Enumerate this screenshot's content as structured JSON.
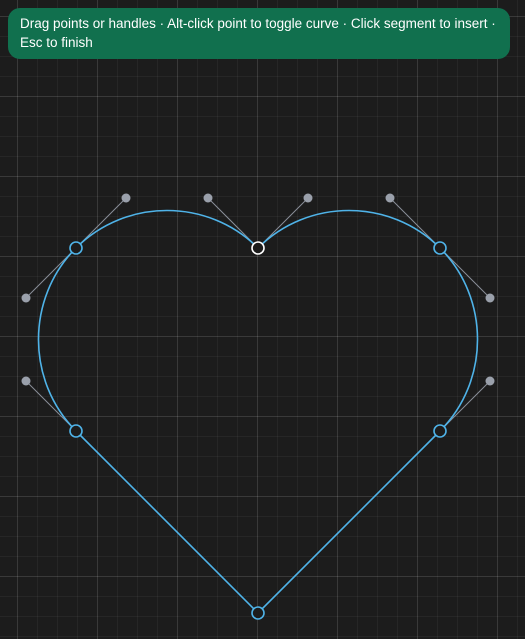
{
  "hint": {
    "text": "Drag points or handles · Alt-click point to toggle curve · Click segment to insert · Esc to finish"
  },
  "colors": {
    "background": "#1c1c1c",
    "banner": "#11704e",
    "path_stroke": "#4fb3e8",
    "anchor_fill": "#1c1c1c",
    "selected_anchor_stroke": "#ffffff",
    "handle_fill": "#9aa0ab",
    "handle_line": "#8a8f99"
  },
  "icons": {
    "anchor": "circle-anchor-point",
    "handle": "filled-circle-handle"
  }
}
